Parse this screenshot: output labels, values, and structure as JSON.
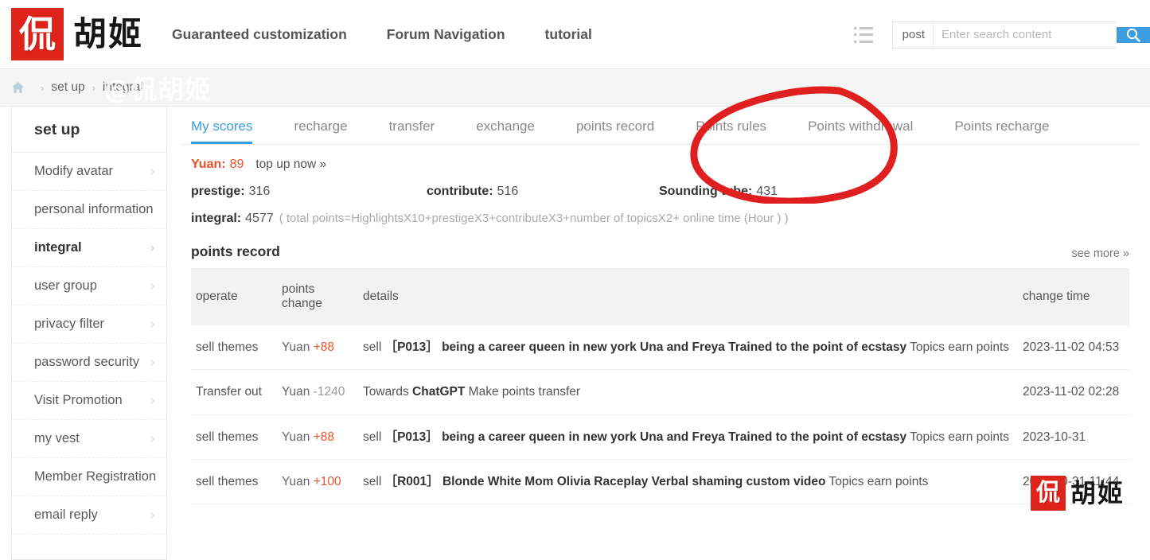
{
  "header": {
    "logo": {
      "seal_char": "侃",
      "brand_cn": "胡姬",
      "icon": "seal-logo"
    },
    "nav": [
      {
        "label": "Guaranteed customization"
      },
      {
        "label": "Forum Navigation"
      },
      {
        "label": "tutorial"
      }
    ],
    "list_icon": "list-icon",
    "search": {
      "category": "post",
      "placeholder": "Enter search content",
      "value": "",
      "button_icon": "search-icon",
      "button_color": "#3a9ee0"
    }
  },
  "breadcrumb": {
    "home_icon": "home-icon",
    "items": [
      {
        "label": "set up"
      },
      {
        "label": "integral"
      }
    ],
    "separator": "›",
    "watermark": "@侃胡姬"
  },
  "sidebar": {
    "title": "set up",
    "items": [
      {
        "label": "Modify avatar",
        "active": false
      },
      {
        "label": "personal information",
        "active": false
      },
      {
        "label": "integral",
        "active": true
      },
      {
        "label": "user group",
        "active": false
      },
      {
        "label": "privacy filter",
        "active": false
      },
      {
        "label": "password security",
        "active": false
      },
      {
        "label": "Visit Promotion",
        "active": false
      },
      {
        "label": "my vest",
        "active": false
      },
      {
        "label": "Member Registration",
        "active": false
      },
      {
        "label": "email reply",
        "active": false
      }
    ],
    "chevron": "›"
  },
  "tabs": [
    {
      "label": "My scores",
      "active": true
    },
    {
      "label": "recharge",
      "active": false
    },
    {
      "label": "transfer",
      "active": false
    },
    {
      "label": "exchange",
      "active": false
    },
    {
      "label": "points record",
      "active": false
    },
    {
      "label": "Points rules",
      "active": false
    },
    {
      "label": "Points withdrawal",
      "active": false
    },
    {
      "label": "Points recharge",
      "active": false
    }
  ],
  "stats": {
    "yuan_label": "Yuan:",
    "yuan_value": "89",
    "topup_link": "top up now »",
    "prestige_label": "prestige:",
    "prestige_value": "316",
    "contribute_label": "contribute:",
    "contribute_value": "516",
    "sounding_label": "Sounding tube:",
    "sounding_value": "431",
    "integral_label": "integral:",
    "integral_value": "4577",
    "integral_formula": "( total points=HighlightsX10+prestigeX3+contributeX3+number of topicsX2+ online time (Hour ) )"
  },
  "points_record": {
    "title": "points record",
    "see_more": "see more »",
    "columns": [
      "operate",
      "points change",
      "details",
      "change time"
    ],
    "rows": [
      {
        "operate": "sell themes",
        "currency": "Yuan",
        "amount": "+88",
        "amount_sign": "positive",
        "detail_action": "sell",
        "detail_code": "［P013］",
        "detail_title": "being a career queen in new york Una and Freya Trained to the point of ecstasy",
        "detail_tail": "Topics earn points",
        "time": "2023-11-02 04:53"
      },
      {
        "operate": "Transfer out",
        "currency": "Yuan",
        "amount": "-1240",
        "amount_sign": "negative",
        "detail_action": "Towards",
        "detail_code": "",
        "detail_title": "ChatGPT",
        "detail_tail": "Make points transfer",
        "time": "2023-11-02 02:28"
      },
      {
        "operate": "sell themes",
        "currency": "Yuan",
        "amount": "+88",
        "amount_sign": "positive",
        "detail_action": "sell",
        "detail_code": "［P013］",
        "detail_title": "being a career queen in new york Una and Freya Trained to the point of ecstasy",
        "detail_tail": "Topics earn points",
        "time": "2023-10-31"
      },
      {
        "operate": "sell themes",
        "currency": "Yuan",
        "amount": "+100",
        "amount_sign": "positive",
        "detail_action": "sell",
        "detail_code": "［R001］",
        "detail_title": "Blonde White Mom Olivia Raceplay Verbal shaming custom video",
        "detail_tail": "Topics earn points",
        "time": "2023-10-31 11:44"
      }
    ]
  },
  "annotation": {
    "type": "hand-drawn-circle",
    "color": "#e02020",
    "targets": "Points rules / Points withdrawal tabs"
  },
  "row_watermark": {
    "seal_char": "侃",
    "brand_cn": "胡姬"
  }
}
